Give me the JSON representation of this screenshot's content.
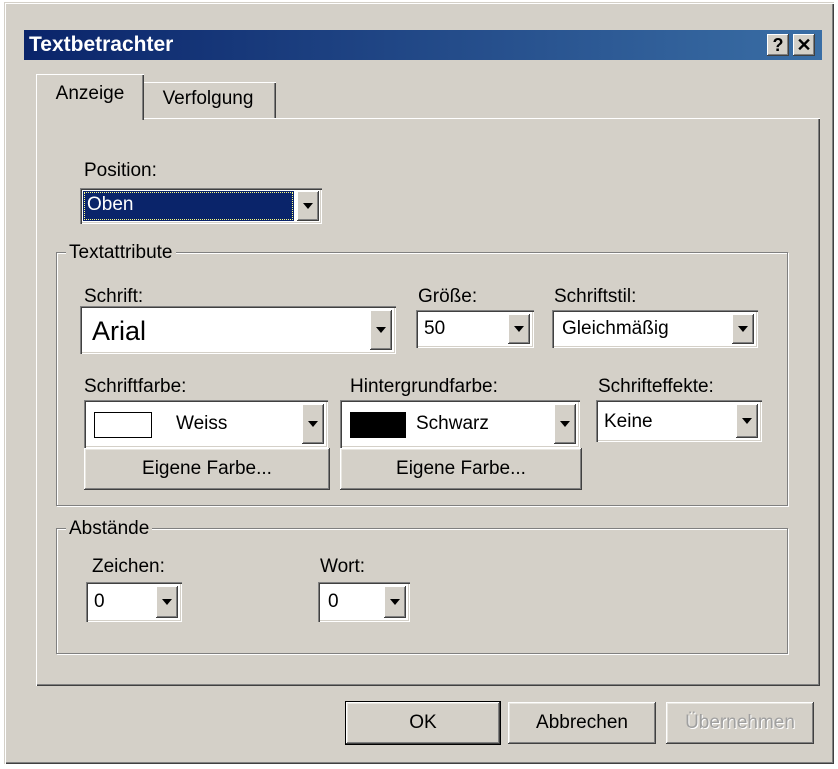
{
  "window": {
    "title": "Textbetrachter",
    "help_button": "?",
    "close_button": "✕"
  },
  "tabs": [
    {
      "label": "Anzeige",
      "active": true
    },
    {
      "label": "Verfolgung",
      "active": false
    }
  ],
  "position": {
    "label": "Position:",
    "value": "Oben"
  },
  "textattribute": {
    "group_label": "Textattribute",
    "font": {
      "label": "Schrift:",
      "value": "Arial"
    },
    "size": {
      "label": "Größe:",
      "value": "50"
    },
    "style": {
      "label": "Schriftstil:",
      "value": "Gleichmäßig"
    },
    "font_color": {
      "label": "Schriftfarbe:",
      "value": "Weiss",
      "swatch": "#ffffff",
      "custom_button": "Eigene Farbe..."
    },
    "background_color": {
      "label": "Hintergrundfarbe:",
      "value": "Schwarz",
      "swatch": "#000000",
      "custom_button": "Eigene Farbe..."
    },
    "effects": {
      "label": "Schrifteffekte:",
      "value": "Keine"
    }
  },
  "spacing": {
    "group_label": "Abstände",
    "char": {
      "label": "Zeichen:",
      "value": "0"
    },
    "word": {
      "label": "Wort:",
      "value": "0"
    }
  },
  "buttons": {
    "ok": "OK",
    "cancel": "Abbrechen",
    "apply": "Übernehmen"
  },
  "colors": {
    "titlebar_start": "#0a246a",
    "titlebar_end": "#3a6ea5",
    "dialog_face": "#d4d0c8",
    "selection": "#0a246a"
  }
}
